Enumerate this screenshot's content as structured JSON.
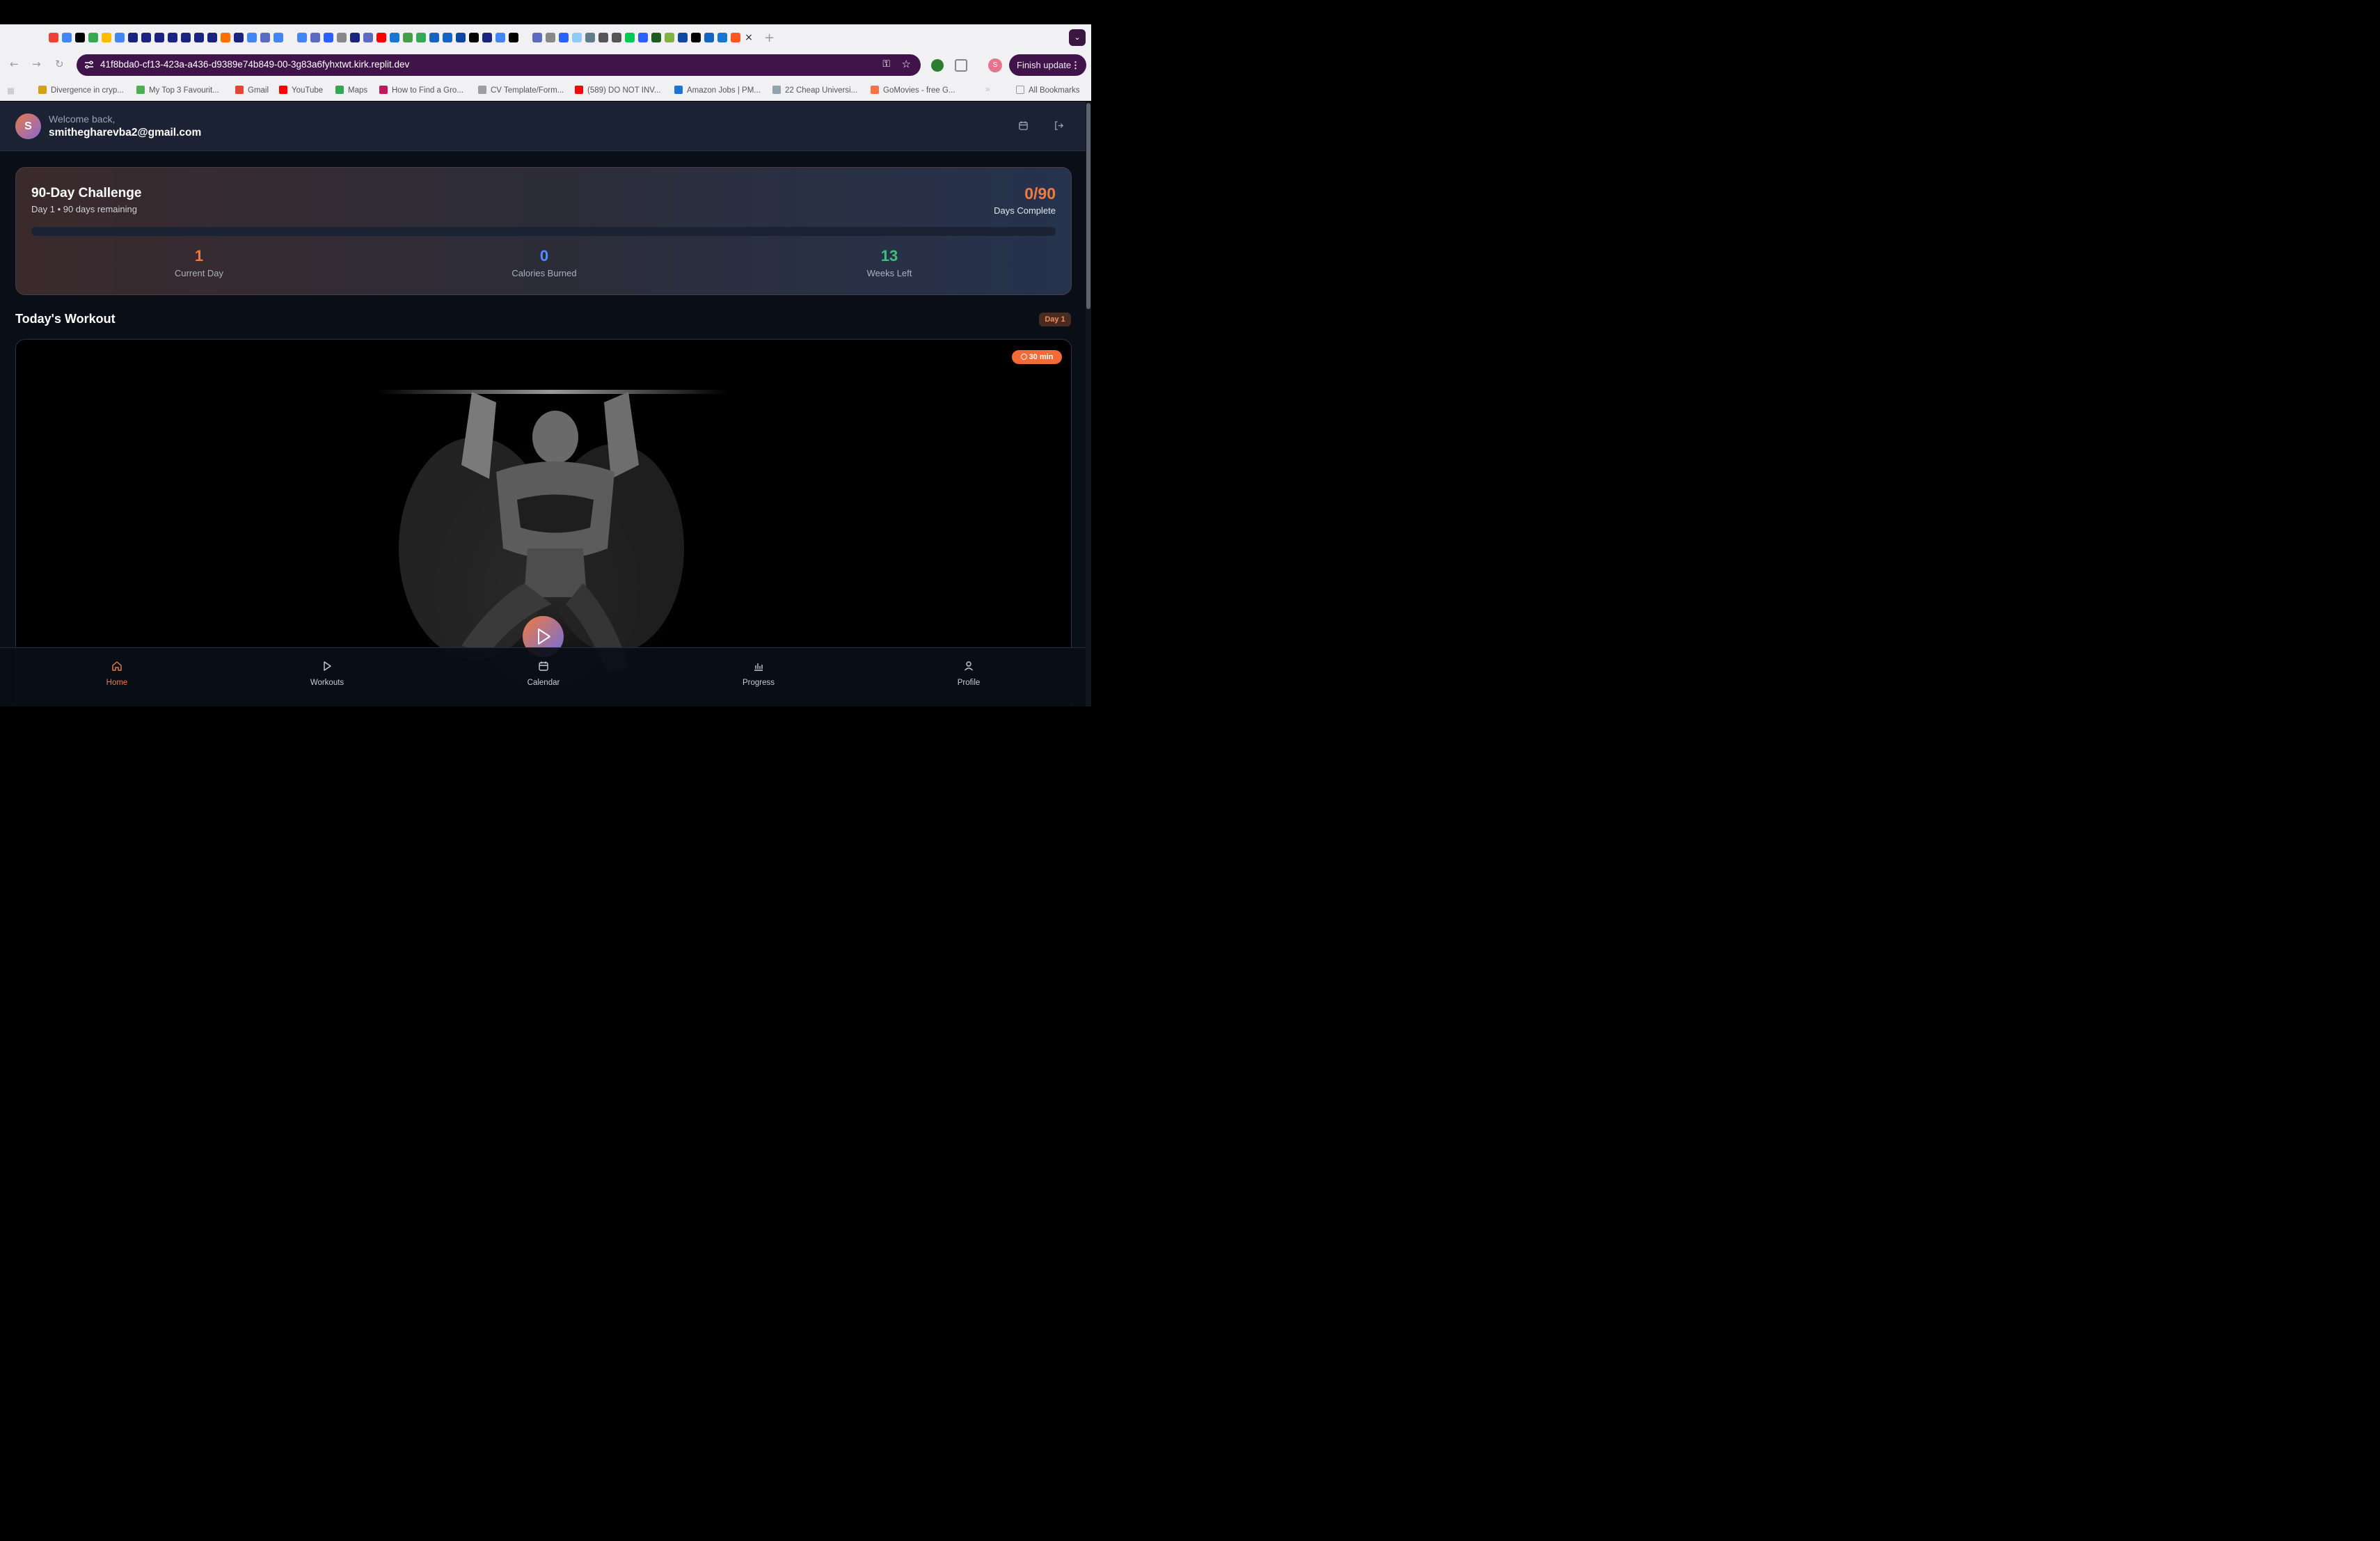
{
  "browser": {
    "url": "41f8bda0-cf13-423a-a436-d9389e74b849-00-3g83a6fyhxtwt.kirk.replit.dev",
    "finish_update_label": "Finish update",
    "profile_initial": "S",
    "bookmarks": [
      {
        "label": "Divergence in cryp...",
        "icon": "chart-icon",
        "color": "#d4a017"
      },
      {
        "label": "My Top 3 Favourit...",
        "icon": "clock-icon",
        "color": "#4caf50"
      },
      {
        "label": "Gmail",
        "icon": "gmail-icon",
        "color": "#ea4335"
      },
      {
        "label": "YouTube",
        "icon": "youtube-icon",
        "color": "#ff0000"
      },
      {
        "label": "Maps",
        "icon": "maps-icon",
        "color": "#34a853"
      },
      {
        "label": "How to Find a Gro...",
        "icon": "link-icon",
        "color": "#c2185b"
      },
      {
        "label": "CV Template/Form...",
        "icon": "doc-icon",
        "color": "#9e9e9e"
      },
      {
        "label": "(589) DO NOT INV...",
        "icon": "youtube-icon",
        "color": "#ff0000"
      },
      {
        "label": "Amazon Jobs | PM...",
        "icon": "amazon-icon",
        "color": "#1976d2"
      },
      {
        "label": "22 Cheap Universi...",
        "icon": "bell-icon",
        "color": "#90a4ae"
      },
      {
        "label": "GoMovies - free G...",
        "icon": "rainbow-icon",
        "color": "#ff7043"
      }
    ],
    "all_bookmarks_label": "All Bookmarks"
  },
  "app": {
    "header": {
      "avatar_initial": "S",
      "welcome": "Welcome back,",
      "email": "smithegharevba2@gmail.com"
    },
    "challenge": {
      "title": "90-Day Challenge",
      "subtitle": "Day 1 • 90 days remaining",
      "fraction": "0/90",
      "fraction_label": "Days Complete",
      "progress": 0,
      "stats": [
        {
          "value": "1",
          "label": "Current Day",
          "color": "#f07b3f"
        },
        {
          "value": "0",
          "label": "Calories Burned",
          "color": "#4f8ff7"
        },
        {
          "value": "13",
          "label": "Weeks Left",
          "color": "#3fbf7f"
        }
      ]
    },
    "workout": {
      "section_title": "Today's Workout",
      "day_badge": "Day 1",
      "duration": "30 min"
    },
    "nav": [
      {
        "label": "Home",
        "icon": "home-icon",
        "active": true
      },
      {
        "label": "Workouts",
        "icon": "play-icon",
        "active": false
      },
      {
        "label": "Calendar",
        "icon": "calendar-icon",
        "active": false
      },
      {
        "label": "Progress",
        "icon": "bar-chart-icon",
        "active": false
      },
      {
        "label": "Profile",
        "icon": "user-icon",
        "active": false
      }
    ]
  },
  "colors": {
    "accent": "#f07b3f",
    "blue": "#4f8ff7",
    "green": "#3fbf7f",
    "background": "#0a0e17"
  }
}
